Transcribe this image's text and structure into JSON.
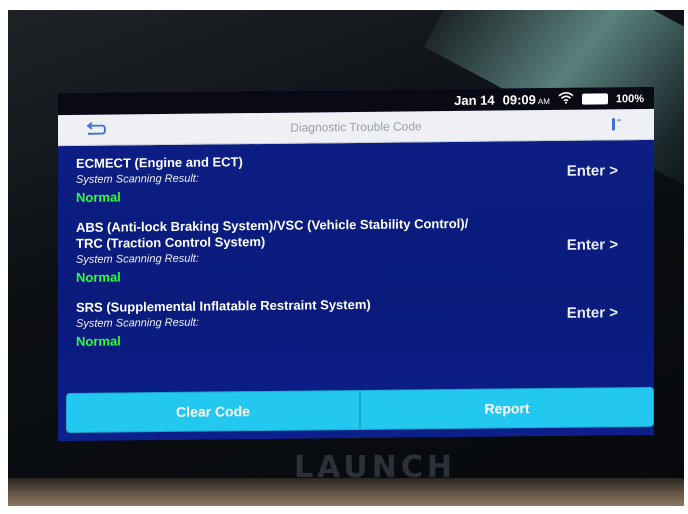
{
  "statusbar": {
    "date": "Jan 14",
    "time": "09:09",
    "ampm": "AM",
    "battery": "100%"
  },
  "titlebar": {
    "title": "Diagnostic Trouble Code"
  },
  "systems": [
    {
      "title_line1": "ECMECT (Engine and ECT)",
      "title_line2": "",
      "result_label": "System Scanning Result:",
      "status": "Normal",
      "enter": "Enter >"
    },
    {
      "title_line1": "ABS (Anti-lock Braking System)/VSC (Vehicle Stability Control)/",
      "title_line2": "TRC (Traction Control System)",
      "result_label": "System Scanning Result:",
      "status": "Normal",
      "enter": "Enter >"
    },
    {
      "title_line1": "SRS (Supplemental Inflatable Restraint System)",
      "title_line2": "",
      "result_label": "System Scanning Result:",
      "status": "Normal",
      "enter": "Enter >"
    }
  ],
  "actions": {
    "clear_code": "Clear Code",
    "report": "Report"
  },
  "device": {
    "brand": "LAUNCH"
  },
  "colors": {
    "screen_bg": "#0b1a7a",
    "status_ok": "#25ff3c",
    "button_bg": "#22c8ef"
  }
}
